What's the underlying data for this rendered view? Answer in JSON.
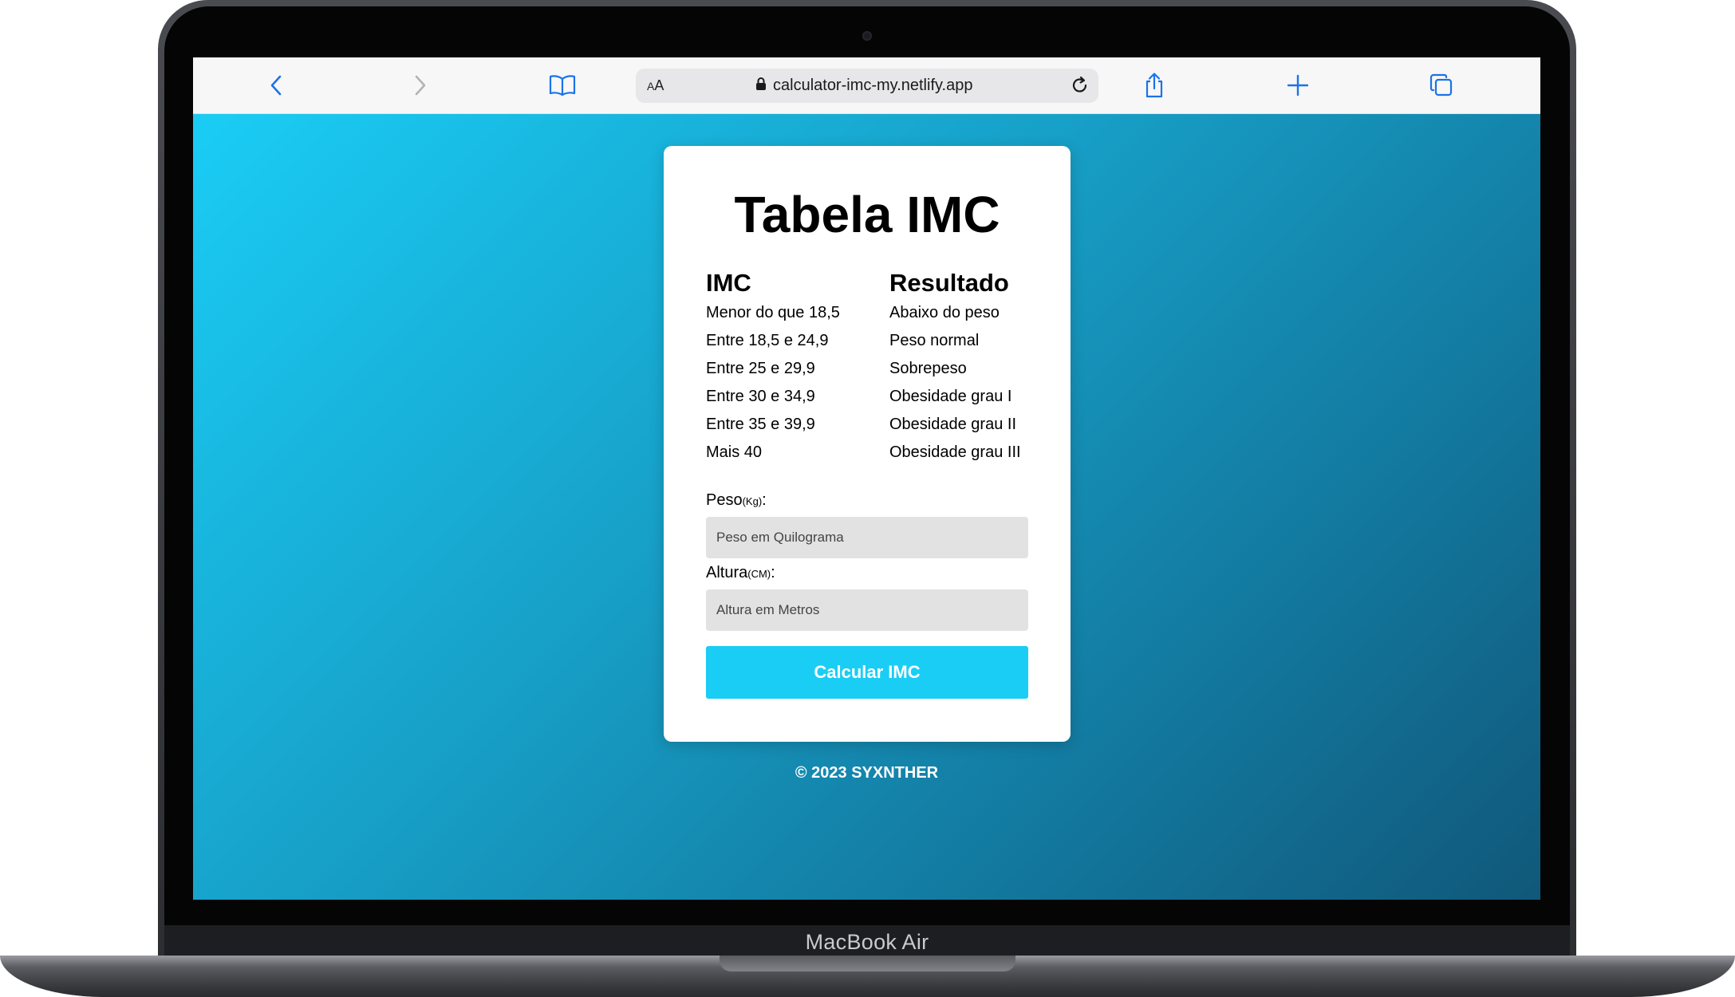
{
  "device": {
    "model_label": "MacBook Air"
  },
  "browser": {
    "reader_label_big": "A",
    "reader_label_small": "A",
    "url": "calculator-imc-my.netlify.app",
    "icons": {
      "back": "chevron-left-icon",
      "forward": "chevron-right-icon",
      "bookmarks": "book-icon",
      "lock": "lock-icon",
      "reload": "reload-icon",
      "share": "share-icon",
      "new_tab": "plus-icon",
      "tabs": "tabs-icon"
    },
    "accent_color": "#1a73e8"
  },
  "page": {
    "background_colors": [
      "#1acdf5",
      "#10587a"
    ],
    "card": {
      "title": "Tabela IMC",
      "table": {
        "headers": [
          "IMC",
          "Resultado"
        ],
        "rows": [
          [
            "Menor do que 18,5",
            "Abaixo do peso"
          ],
          [
            "Entre 18,5 e 24,9",
            "Peso normal"
          ],
          [
            "Entre 25 e 29,9",
            "Sobrepeso"
          ],
          [
            "Entre 30 e 34,9",
            "Obesidade grau I"
          ],
          [
            "Entre 35 e 39,9",
            "Obesidade grau II"
          ],
          [
            "Mais 40",
            "Obesidade grau III"
          ]
        ]
      },
      "form": {
        "weight_label": "Peso",
        "weight_unit": "(Kg)",
        "weight_suffix": ":",
        "weight_placeholder": "Peso em Quilograma",
        "height_label": "Altura",
        "height_unit": "(CM)",
        "height_suffix": ":",
        "height_placeholder": "Altura em Metros",
        "button_label": "Calcular IMC",
        "button_color": "#1acdf5"
      }
    },
    "footer": "© 2023 SYXNTHER"
  }
}
